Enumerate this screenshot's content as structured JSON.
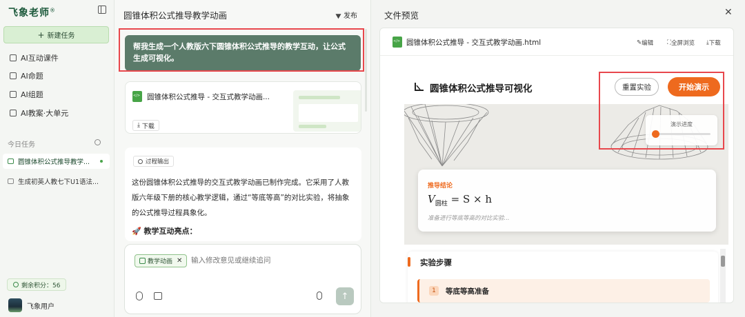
{
  "sidebar": {
    "logo": "飞象老师",
    "logo_mark": "®",
    "new_task": "新建任务",
    "nav": [
      {
        "label": "AI互动课件",
        "icon": "courseware-icon"
      },
      {
        "label": "AI命题",
        "icon": "question-icon"
      },
      {
        "label": "AI组题",
        "icon": "paper-icon"
      },
      {
        "label": "AI教案·大单元",
        "icon": "lesson-plan-icon"
      }
    ],
    "today_label": "今日任务",
    "tasks": [
      {
        "label": "圆锥体积公式推导教学...",
        "active": true
      },
      {
        "label": "生成初英人教七下U1语法..."
      }
    ],
    "credits": "剩余积分：56",
    "user_name": "飞象用户"
  },
  "chat": {
    "title": "圆锥体积公式推导教学动画",
    "publish": "发布",
    "user_message": "帮我生成一个人教版六下圆锥体积公式推导的教学互动，让公式生成可视化。",
    "file_name": "圆锥体积公式推导 - 交互式教学动画...",
    "download": "下载",
    "process_badge": "过程输出",
    "answer_text": "这份圆锥体积公式推导的交互式教学动画已制作完成。它采用了人教版六年级下册的核心教学逻辑，通过“等底等高”的对比实验，将抽象的公式推导过程具象化。",
    "answer_heading": "🚀 教学互动亮点：",
    "chip": "教学动画",
    "input_placeholder": "输入修改意见或继续追问"
  },
  "preview": {
    "title": "文件预览",
    "file_name": "圆锥体积公式推导 - 交互式教学动画.html",
    "actions": {
      "edit": "编辑",
      "fullscreen": "全屏浏览",
      "download": "下载"
    },
    "page": {
      "title": "圆锥体积公式推导可视化",
      "reset": "重置实验",
      "start": "开始演示",
      "progress_label": "演示进度",
      "progress": 0.05,
      "result_label": "推导结论",
      "formula_v": "V",
      "formula_sub": "圆柱",
      "formula_rest": " = S × h",
      "status": "准备进行等底等高的对比实验...",
      "steps_title": "实验步骤",
      "step_num": "1",
      "step_text": "等底等高准备"
    }
  },
  "colors": {
    "accent": "#ee6a1e",
    "brand": "#5b7b6a",
    "highlight": "#e8474c"
  }
}
